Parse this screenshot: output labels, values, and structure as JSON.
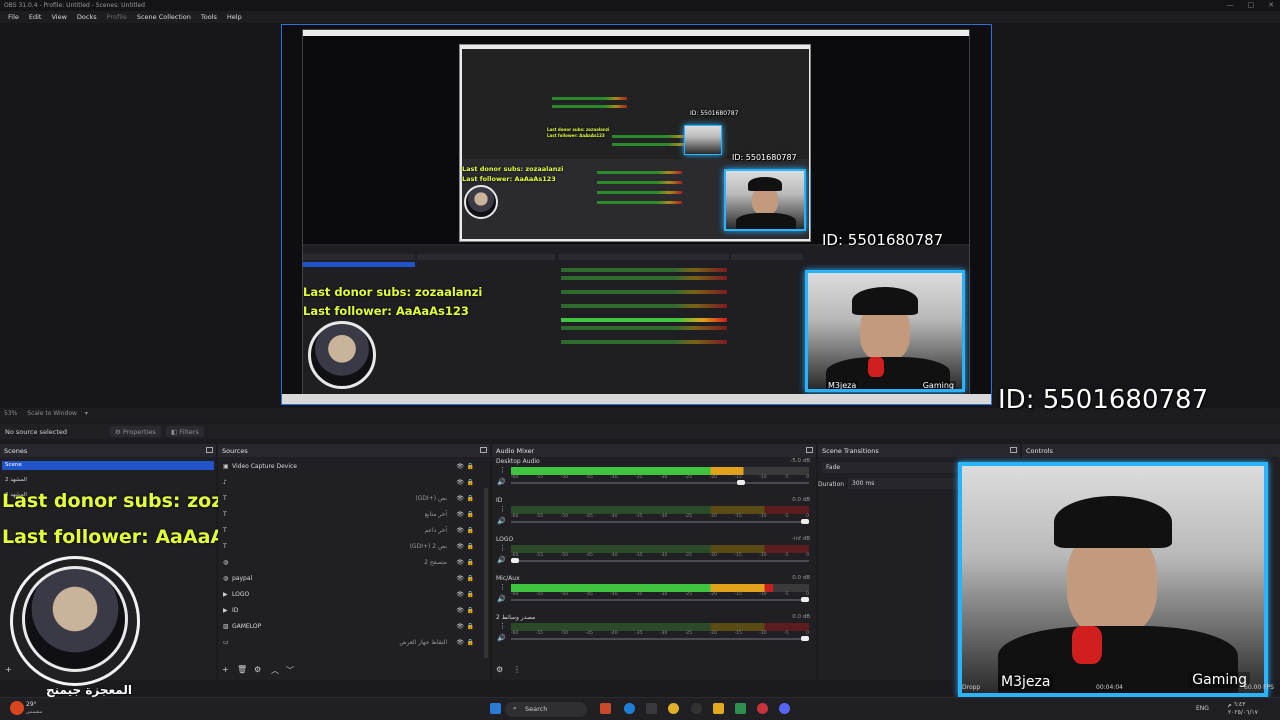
{
  "window": {
    "title": "OBS 31.0.4 - Profile: Untitled - Scenes: Untitled",
    "controls": [
      "—",
      "□",
      "✕"
    ]
  },
  "menu": {
    "items": [
      {
        "label": "File",
        "enabled": true
      },
      {
        "label": "Edit",
        "enabled": true
      },
      {
        "label": "View",
        "enabled": true
      },
      {
        "label": "Docks",
        "enabled": true
      },
      {
        "label": "Profile",
        "enabled": false
      },
      {
        "label": "Scene Collection",
        "enabled": true
      },
      {
        "label": "Tools",
        "enabled": true
      },
      {
        "label": "Help",
        "enabled": true
      }
    ]
  },
  "preview": {
    "id_overlay": "ID: 5501680787",
    "donor_text": "Last donor subs: zozaalanzi",
    "follower_text": "Last follower: AaAaAs123",
    "webcam_name": "M3jeza",
    "webcam_tag": "Gaming",
    "avatar_caption": "المعجزة جيمنج"
  },
  "status": {
    "zoom": "53%",
    "scale_mode": "Scale to Window"
  },
  "context_bar": {
    "no_source": "No source selected",
    "properties": "Properties",
    "filters": "Filters"
  },
  "scenes": {
    "title": "Scenes",
    "items": [
      {
        "label": "Scene",
        "selected": true
      },
      {
        "label": "المشهد 2",
        "selected": false
      },
      {
        "label": "المشهد 3",
        "selected": false
      }
    ]
  },
  "sources": {
    "title": "Sources",
    "items": [
      {
        "label": "Video Capture Device",
        "icon": "camera-icon",
        "rtl": false
      },
      {
        "label": "",
        "icon": "audio-icon",
        "rtl": false
      },
      {
        "label": "(GDI+) نص",
        "icon": "text-icon",
        "rtl": true
      },
      {
        "label": "آخر متابع",
        "icon": "text-icon",
        "rtl": true
      },
      {
        "label": "آخر داعم",
        "icon": "text-icon",
        "rtl": true
      },
      {
        "label": "(GDI+) نص 2",
        "icon": "text-icon",
        "rtl": true
      },
      {
        "label": "متصفح 2",
        "icon": "globe-icon",
        "rtl": true
      },
      {
        "label": "paypal",
        "icon": "globe-icon",
        "rtl": false
      },
      {
        "label": "LOGO",
        "icon": "media-icon",
        "rtl": false
      },
      {
        "label": "ID",
        "icon": "media-icon",
        "rtl": false
      },
      {
        "label": "GAMELOP",
        "icon": "image-icon",
        "rtl": false
      },
      {
        "label": "التقاط جهاز العرض",
        "icon": "monitor-icon",
        "rtl": true
      }
    ]
  },
  "mixer": {
    "title": "Audio Mixer",
    "scale": [
      "-60",
      "-55",
      "-50",
      "-45",
      "-40",
      "-35",
      "-30",
      "-25",
      "-20",
      "-15",
      "-10",
      "-5",
      "0"
    ],
    "channels": [
      {
        "name": "Desktop Audio",
        "db": "-5.0 dB",
        "level": 0.78,
        "fader": 0.78
      },
      {
        "name": "ID",
        "db": "0.0 dB",
        "level": 0.0,
        "fader": 1.0
      },
      {
        "name": "LOGO",
        "db": "-inf dB",
        "level": 0.0,
        "fader": 0.0
      },
      {
        "name": "Mic/Aux",
        "db": "0.0 dB",
        "level": 0.88,
        "fader": 1.0
      },
      {
        "name": "مصدر وسائط 2",
        "db": "0.0 dB",
        "level": 0.0,
        "fader": 1.0
      }
    ]
  },
  "transitions": {
    "title": "Scene Transitions",
    "type": "Fade",
    "duration_label": "Duration",
    "duration_value": "300 ms"
  },
  "controls": {
    "title": "Controls",
    "timer": "00:04:04",
    "fps": "60.00 FPS",
    "dropped_label": "Dropp"
  },
  "taskbar": {
    "search": "Search",
    "lang": "ENG",
    "time": "٦:٤٣ م",
    "date": "٢٠٢٥/٠٦/١٧",
    "weather": "29°",
    "weather_sub": "مشمس"
  },
  "colors": {
    "accent": "#2154c9",
    "overlay_yellow": "#e4ff3a",
    "webcam_border": "#2ab3ff",
    "meter_green": "#3ec43e",
    "meter_yellow": "#e0a21a",
    "meter_red": "#c81f1f"
  }
}
